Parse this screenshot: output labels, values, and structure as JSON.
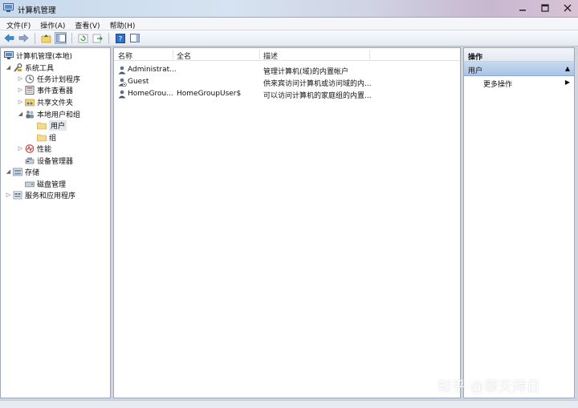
{
  "window": {
    "title": "计算机管理",
    "controls": [
      "minimize-icon",
      "maximize-icon",
      "close-icon"
    ]
  },
  "menubar": [
    "文件(F)",
    "操作(A)",
    "查看(V)",
    "帮助(H)"
  ],
  "toolbar_icons": [
    "back-arrow-icon",
    "forward-arrow-icon",
    "up-folder-icon",
    "show-hide-tree-icon",
    "refresh-icon",
    "export-list-icon",
    "help-icon",
    "show-hide-action-pane-icon"
  ],
  "tree": {
    "root": "计算机管理(本地)",
    "system_tools": "系统工具",
    "task_scheduler": "任务计划程序",
    "event_viewer": "事件查看器",
    "shared_folders": "共享文件夹",
    "local_users_groups": "本地用户和组",
    "users": "用户",
    "groups": "组",
    "performance": "性能",
    "device_manager": "设备管理器",
    "storage": "存储",
    "disk_management": "磁盘管理",
    "services_apps": "服务和应用程序"
  },
  "list": {
    "headers": [
      "名称",
      "全名",
      "描述"
    ],
    "rows": [
      {
        "name": "Administrat...",
        "fullname": "",
        "description": "管理计算机(域)的内置帐户"
      },
      {
        "name": "Guest",
        "fullname": "",
        "description": "供来宾访问计算机或访问域的内..."
      },
      {
        "name": "HomeGrou...",
        "fullname": "HomeGroupUser$",
        "description": "可以访问计算机的家庭组的内置..."
      }
    ]
  },
  "actions": {
    "header": "操作",
    "selected": "用户",
    "more": "更多操作"
  },
  "watermark": "知乎 @擎天拜日"
}
